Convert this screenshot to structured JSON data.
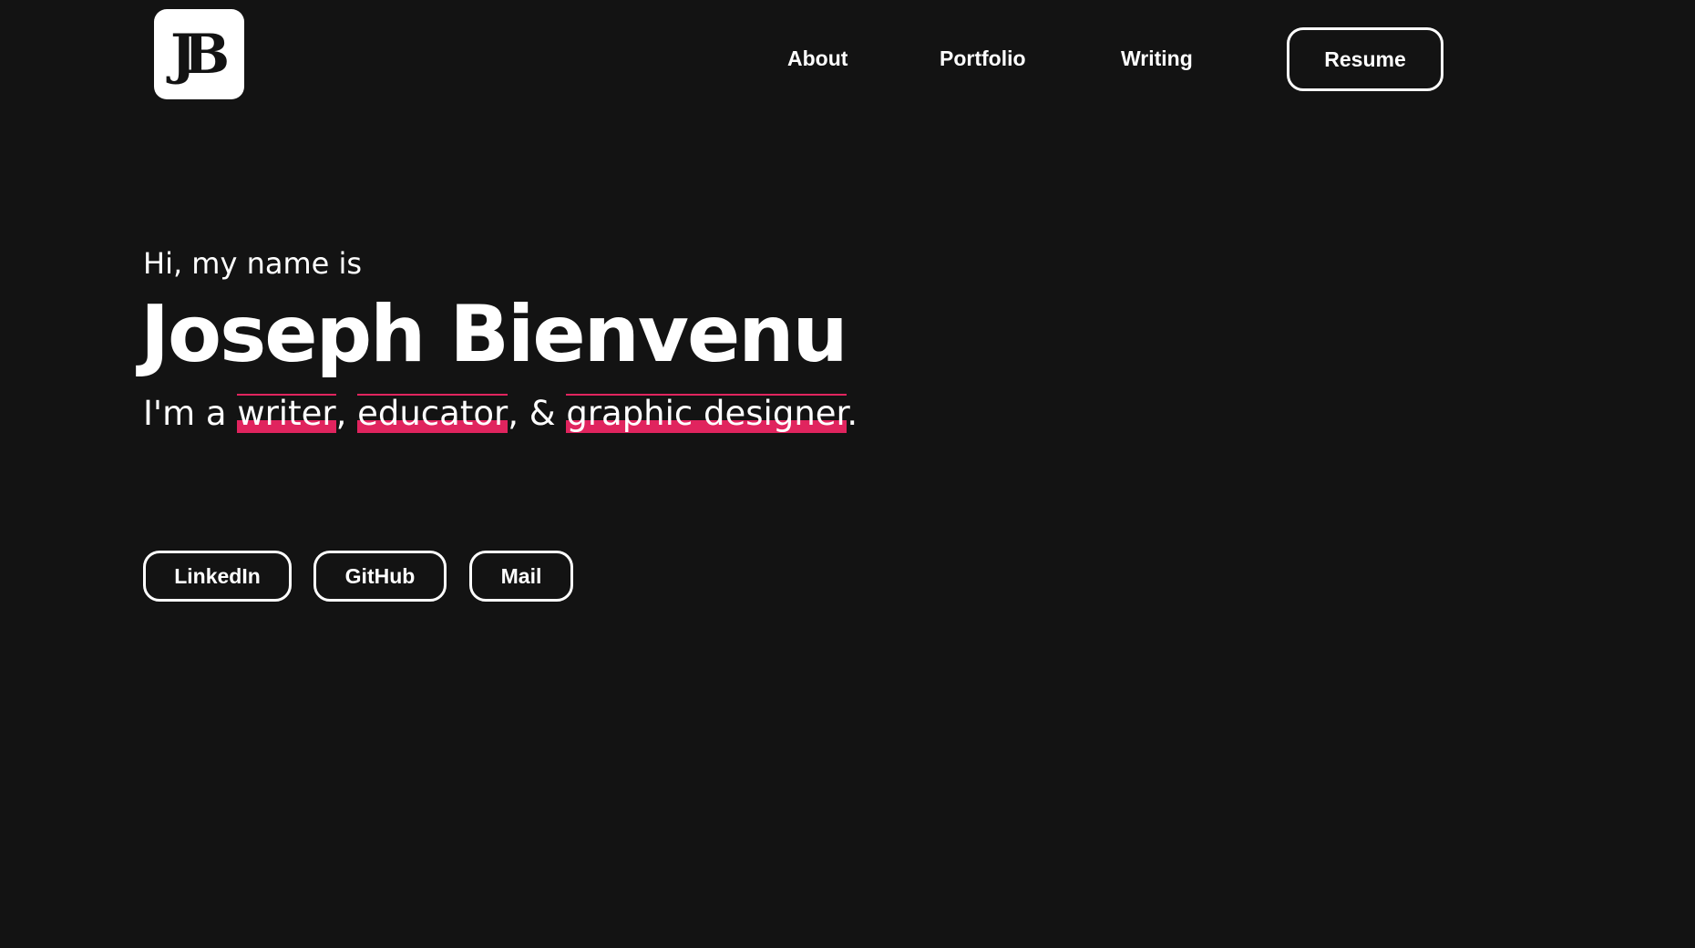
{
  "header": {
    "logo_text": "JB",
    "nav": {
      "about": "About",
      "portfolio": "Portfolio",
      "writing": "Writing",
      "resume": "Resume"
    }
  },
  "hero": {
    "greeting": "Hi, my name is",
    "name": "Joseph Bienvenu",
    "tagline": {
      "prefix": "I'm a ",
      "role1": "writer",
      "sep1": ", ",
      "role2": "educator",
      "sep2": ", & ",
      "role3": "graphic designer",
      "suffix": "."
    },
    "highlight_color": "#e0245e"
  },
  "social": {
    "linkedin": "LinkedIn",
    "github": "GitHub",
    "mail": "Mail"
  },
  "colors": {
    "background": "#131313",
    "text": "#ffffff",
    "accent": "#e0245e"
  }
}
